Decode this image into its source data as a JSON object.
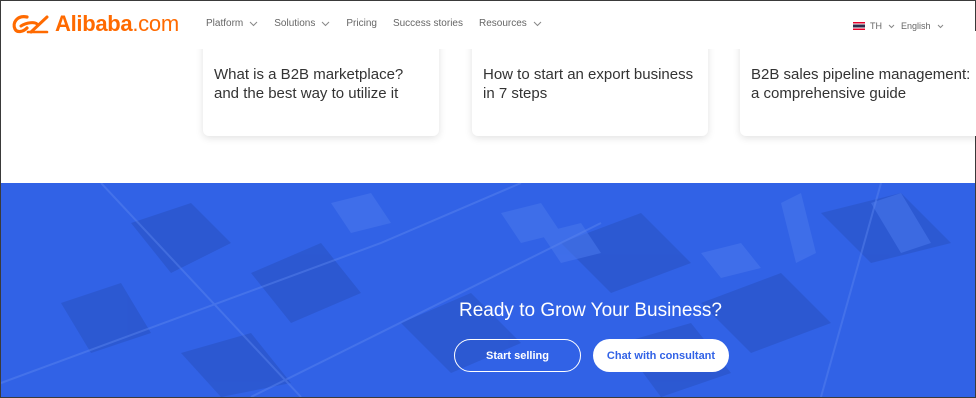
{
  "header": {
    "logo_text": "Alibaba",
    "logo_suffix": ".com",
    "nav": [
      {
        "label": "Platform",
        "has_dropdown": true
      },
      {
        "label": "Solutions",
        "has_dropdown": true
      },
      {
        "label": "Pricing",
        "has_dropdown": false
      },
      {
        "label": "Success stories",
        "has_dropdown": false
      },
      {
        "label": "Resources",
        "has_dropdown": true
      }
    ],
    "region": "TH",
    "language": "English"
  },
  "cards": [
    {
      "title": "What is a B2B marketplace? and the best way to utilize it"
    },
    {
      "title": "How to start an export business in 7 steps"
    },
    {
      "title": "B2B sales pipeline management: a comprehensive guide"
    }
  ],
  "banner": {
    "title": "Ready to Grow Your Business?",
    "start_label": "Start selling",
    "chat_label": "Chat with consultant"
  },
  "colors": {
    "brand_orange": "#ff6a00",
    "banner_blue": "#3162e6"
  },
  "icons": [
    "alibaba-logo-icon",
    "chevron-down-icon",
    "thailand-flag-icon"
  ]
}
